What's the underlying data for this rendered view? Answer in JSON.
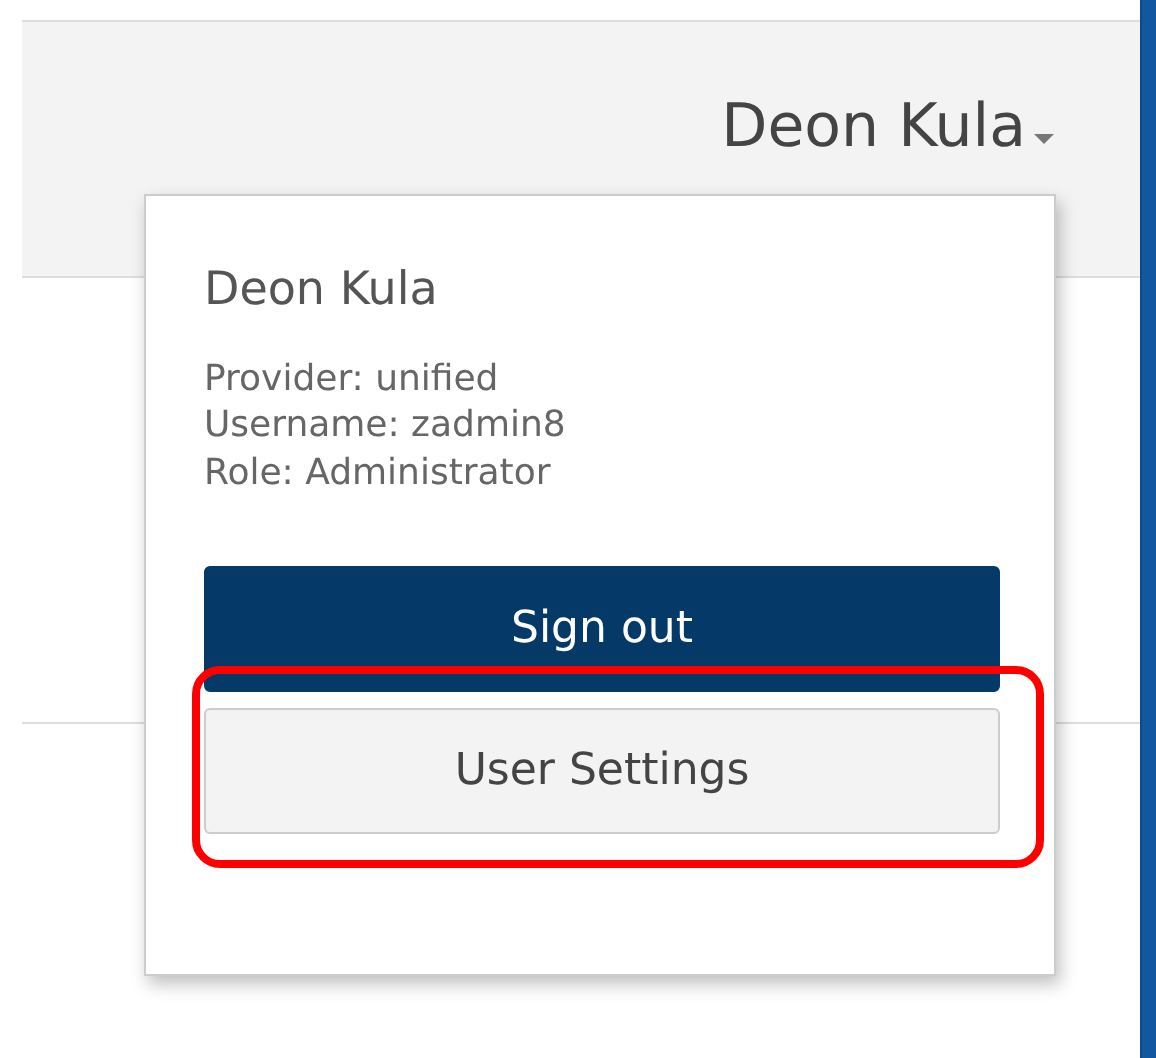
{
  "header": {
    "user_name": "Deon Kula"
  },
  "user_menu": {
    "name": "Deon Kula",
    "details": [
      "Provider: unified",
      "Username: zadmin8",
      "Role: Administrator"
    ],
    "buttons": [
      {
        "label": "Sign out",
        "kind": "primary",
        "highlighted": false
      },
      {
        "label": "User Settings",
        "kind": "secondary",
        "highlighted": true
      }
    ]
  }
}
